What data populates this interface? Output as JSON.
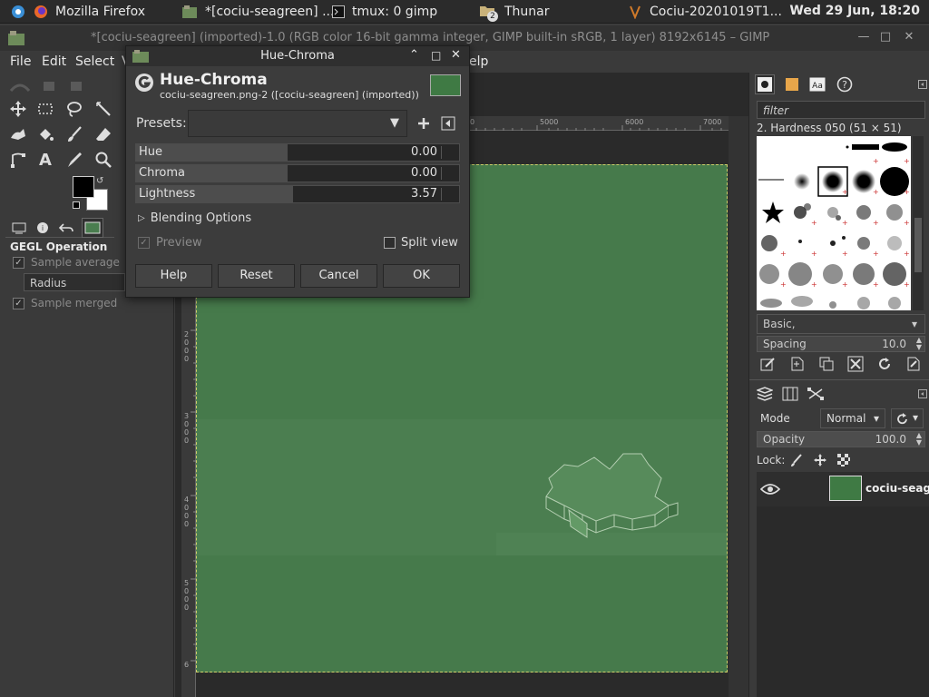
{
  "taskbar": {
    "items": [
      {
        "label": "Mozilla Firefox"
      },
      {
        "label": "*[cociu-seagreen] ..."
      },
      {
        "label": "tmux: 0 gimp"
      },
      {
        "label": "Thunar"
      },
      {
        "label": "Cociu-20201019T1..."
      }
    ],
    "thunar_badge": "2",
    "clock": "Wed 29 Jun, 18:20"
  },
  "window": {
    "title": "*[cociu-seagreen] (imported)-1.0 (RGB color 16-bit gamma integer, GIMP built-in sRGB, 1 layer) 8192x6145 – GIMP"
  },
  "menubar": {
    "items": [
      "File",
      "Edit",
      "Select",
      "V",
      "elp"
    ]
  },
  "tool_options": {
    "title": "GEGL Operation",
    "sample_average": "Sample average",
    "radius_label": "Radius",
    "sample_merged": "Sample merged"
  },
  "rulers": {
    "top": [
      "0",
      "5000",
      "6000",
      "7000"
    ],
    "left": [
      "2000",
      "3000",
      "4000",
      "5000",
      "6"
    ]
  },
  "dialog": {
    "title": "Hue-Chroma",
    "header": "Hue-Chroma",
    "subtitle": "cociu-seagreen.png-2 ([cociu-seagreen] (imported))",
    "presets_label": "Presets:",
    "sliders": [
      {
        "label": "Hue",
        "value": "0.00",
        "fill": 0.47
      },
      {
        "label": "Chroma",
        "value": "0.00",
        "fill": 0.47
      },
      {
        "label": "Lightness",
        "value": "3.57",
        "fill": 0.485
      }
    ],
    "blending_options": "Blending Options",
    "preview": "Preview",
    "split_view": "Split view",
    "buttons": {
      "help": "Help",
      "reset": "Reset",
      "cancel": "Cancel",
      "ok": "OK"
    }
  },
  "brushes": {
    "filter_placeholder": "filter",
    "current": "2. Hardness 050 (51 × 51)",
    "set": "Basic,",
    "spacing_label": "Spacing",
    "spacing_value": "10.0"
  },
  "layers": {
    "mode_label": "Mode",
    "mode_value": "Normal",
    "opacity_label": "Opacity",
    "opacity_value": "100.0",
    "lock_label": "Lock:",
    "layer_name": "cociu-seag"
  },
  "colors": {
    "image_green": "#4a7d4f",
    "layer_thumb": "#3f7a44"
  }
}
